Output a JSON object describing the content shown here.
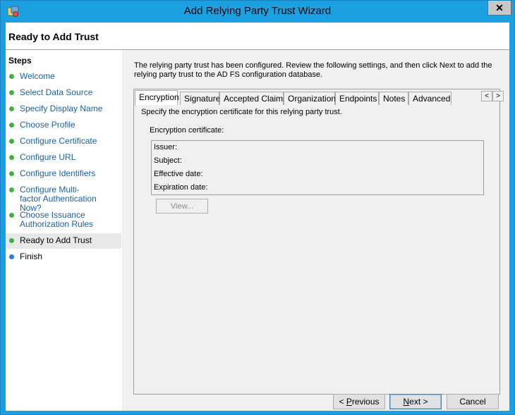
{
  "window": {
    "title": "Add Relying Party Trust Wizard",
    "close_glyph": "✕",
    "icon": "trust-wizard-icon"
  },
  "header": {
    "page_title": "Ready to Add Trust"
  },
  "steps": {
    "heading": "Steps",
    "items": [
      {
        "label": "Welcome",
        "state": "done"
      },
      {
        "label": "Select Data Source",
        "state": "done"
      },
      {
        "label": "Specify Display Name",
        "state": "done"
      },
      {
        "label": "Choose Profile",
        "state": "done"
      },
      {
        "label": "Configure Certificate",
        "state": "done"
      },
      {
        "label": "Configure URL",
        "state": "done"
      },
      {
        "label": "Configure Identifiers",
        "state": "done"
      },
      {
        "label": "Configure Multi-factor Authentication Now?",
        "state": "done"
      },
      {
        "label": "Choose Issuance Authorization Rules",
        "state": "done"
      },
      {
        "label": "Ready to Add Trust",
        "state": "current"
      },
      {
        "label": "Finish",
        "state": "pending"
      }
    ]
  },
  "main": {
    "intro": "The relying party trust has been configured. Review the following settings, and then click Next to add the relying party trust to the AD FS configuration database.",
    "tabs": [
      {
        "label": "Encryption",
        "active": true
      },
      {
        "label": "Signature",
        "active": false
      },
      {
        "label": "Accepted Claims",
        "active": false
      },
      {
        "label": "Organization",
        "active": false
      },
      {
        "label": "Endpoints",
        "active": false
      },
      {
        "label": "Notes",
        "active": false
      },
      {
        "label": "Advanced",
        "active": false
      }
    ],
    "tab_scroll_left": "<",
    "tab_scroll_right": ">",
    "encryption": {
      "description": "Specify the encryption certificate for this relying party trust.",
      "certificate_label": "Encryption certificate:",
      "fields": [
        {
          "label": "Issuer:",
          "value": ""
        },
        {
          "label": "Subject:",
          "value": ""
        },
        {
          "label": "Effective date:",
          "value": ""
        },
        {
          "label": "Expiration date:",
          "value": ""
        }
      ],
      "view_button": "View..."
    }
  },
  "footer": {
    "previous_prefix": "< ",
    "previous_accel": "P",
    "previous_rest": "revious",
    "next_accel": "N",
    "next_rest": "ext >",
    "cancel": "Cancel"
  },
  "colors": {
    "titlebar": "#1ba1e2",
    "step_link": "#1a5fa5",
    "step_done_dot": "#3cb43c",
    "step_pending_dot": "#2a7de1"
  }
}
